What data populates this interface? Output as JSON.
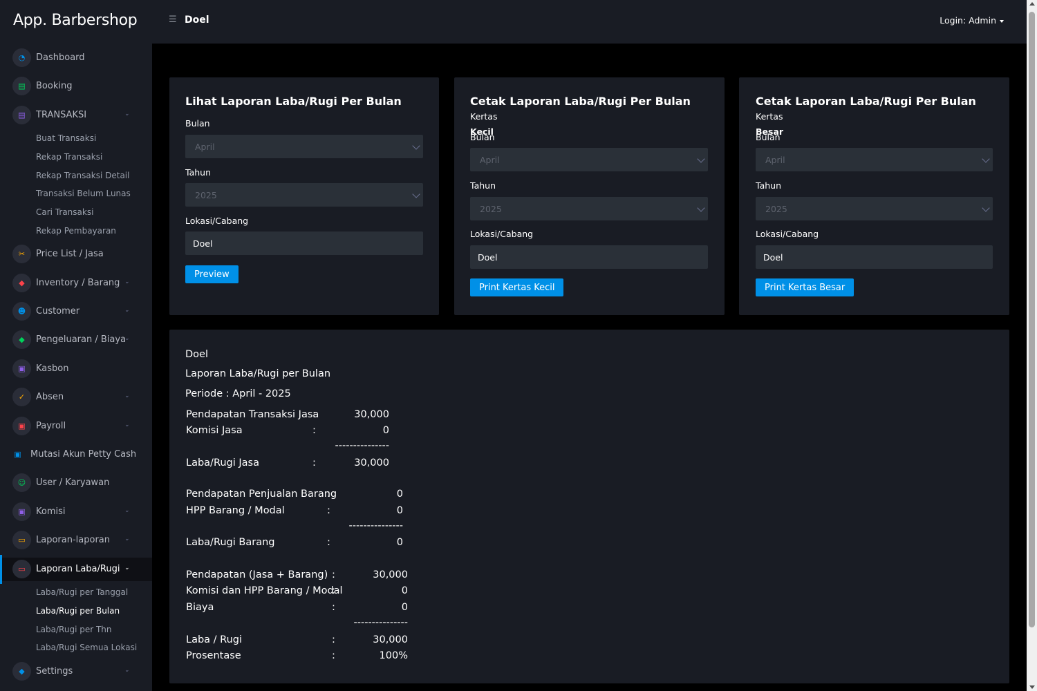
{
  "app_title": "App. Barbershop",
  "header": {
    "page_title": "Doel",
    "login": "Login: Admin",
    "menu_icon": "hamburger-icon"
  },
  "colors": {
    "accent": "#0090e7",
    "sidebar_bg": "#191c24",
    "page_bg": "#000000"
  },
  "sidebar": {
    "items": [
      {
        "label": "Dashboard",
        "icon": "speedometer-icon",
        "icon_color": "#0090e7"
      },
      {
        "label": "Booking",
        "icon": "note-icon",
        "icon_color": "#00d25b"
      },
      {
        "label": "TRANSAKSI",
        "icon": "doc-icon",
        "icon_color": "#8f5fe8"
      },
      {
        "label": "Price List / Jasa",
        "icon": "scissors-icon",
        "icon_color": "#ffab00"
      },
      {
        "label": "Inventory / Barang",
        "icon": "shield-icon",
        "icon_color": "#fc424a"
      },
      {
        "label": "Customer",
        "icon": "people-icon",
        "icon_color": "#0090e7"
      },
      {
        "label": "Pengeluaran / Biaya",
        "icon": "shield-icon",
        "icon_color": "#00d25b"
      },
      {
        "label": "Kasbon",
        "icon": "cash-icon",
        "icon_color": "#8f5fe8"
      },
      {
        "label": "Absen",
        "icon": "check-icon",
        "icon_color": "#ffab00"
      },
      {
        "label": "Payroll",
        "icon": "cash-icon",
        "icon_color": "#fc424a"
      },
      {
        "label": "Mutasi Akun Petty Cash",
        "icon": "cash-icon",
        "icon_color": "#0090e7"
      },
      {
        "label": "User / Karyawan",
        "icon": "user-icon",
        "icon_color": "#00d25b"
      },
      {
        "label": "Komisi",
        "icon": "cash-icon",
        "icon_color": "#8f5fe8"
      },
      {
        "label": "Laporan-laporan",
        "icon": "laptop-icon",
        "icon_color": "#ffab00"
      },
      {
        "label": "Laporan Laba/Rugi",
        "icon": "laptop-icon",
        "icon_color": "#fc424a"
      },
      {
        "label": "Settings",
        "icon": "shield-icon",
        "icon_color": "#0090e7"
      }
    ],
    "transaksi_sub": [
      "Buat Transaksi",
      "Rekap Transaksi",
      "Rekap Transaksi Detail",
      "Transaksi Belum Lunas",
      "Cari Transaksi",
      "Rekap Pembayaran"
    ],
    "labarugi_sub": [
      "Laba/Rugi per Tanggal",
      "Laba/Rugi per Bulan",
      "Laba/Rugi per Thn",
      "Laba/Rugi Semua Lokasi"
    ]
  },
  "cards": [
    {
      "title": "Lihat Laporan Laba/Rugi Per Bulan",
      "subtitle": "",
      "bulan_label": "Bulan",
      "bulan": "April",
      "tahun_label": "Tahun",
      "tahun": "2025",
      "lokasi_label": "Lokasi/Cabang",
      "lokasi": "Doel",
      "button": "Preview"
    },
    {
      "title": "Cetak Laporan Laba/Rugi Per Bulan",
      "subtitle": "Kertas",
      "subtitle2": "Kecil",
      "bulan_label": "Bulan",
      "bulan": "April",
      "tahun_label": "Tahun",
      "tahun": "2025",
      "lokasi_label": "Lokasi/Cabang",
      "lokasi": "Doel",
      "button": "Print Kertas Kecil"
    },
    {
      "title": "Cetak Laporan Laba/Rugi Per Bulan",
      "subtitle": "Kertas",
      "subtitle2": "Besar",
      "bulan_label": "Bulan",
      "bulan": "April",
      "tahun_label": "Tahun",
      "tahun": "2025",
      "lokasi_label": "Lokasi/Cabang",
      "lokasi": "Doel",
      "button": "Print Kertas Besar"
    }
  ],
  "report": {
    "lokasi": "Doel",
    "title": "Laporan Laba/Rugi per Bulan",
    "periode": "Periode : April - 2025",
    "jasa": [
      {
        "label": "Pendapatan Transaksi Jasa",
        "sep": ":",
        "value": "30,000"
      },
      {
        "label": "Komisi Jasa",
        "sep": ":",
        "value": "0"
      },
      {
        "label": "",
        "sep": "",
        "value": "---------------"
      },
      {
        "label": "Laba/Rugi Jasa",
        "sep": ":",
        "value": "30,000"
      }
    ],
    "barang": [
      {
        "label": "Pendapatan Penjualan Barang",
        "sep": ":",
        "value": "0"
      },
      {
        "label": "HPP Barang / Modal",
        "sep": ":",
        "value": "0"
      },
      {
        "label": "",
        "sep": "",
        "value": "---------------"
      },
      {
        "label": "Laba/Rugi Barang",
        "sep": ":",
        "value": "0"
      }
    ],
    "total": [
      {
        "label": "Pendapatan (Jasa + Barang)",
        "sep": ":",
        "value": "30,000"
      },
      {
        "label": "Komisi dan HPP Barang / Modal",
        "sep": ":",
        "value": "0"
      },
      {
        "label": "Biaya",
        "sep": ":",
        "value": "0"
      },
      {
        "label": "",
        "sep": "",
        "value": "---------------"
      },
      {
        "label": "Laba / Rugi",
        "sep": ":",
        "value": "30,000"
      },
      {
        "label": "Prosentase",
        "sep": ":",
        "value": "100%"
      }
    ]
  }
}
